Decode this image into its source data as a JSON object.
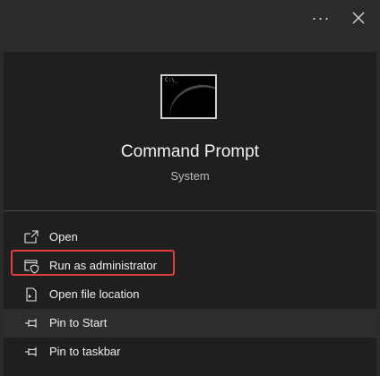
{
  "header": {
    "more_glyph": "···"
  },
  "app": {
    "name": "Command Prompt",
    "category": "System",
    "icon": "terminal-icon",
    "icon_glyph": "C:\\_"
  },
  "menu": {
    "items": [
      {
        "label": "Open",
        "icon": "open-window-icon"
      },
      {
        "label": "Run as administrator",
        "icon": "shield-window-icon"
      },
      {
        "label": "Open file location",
        "icon": "file-location-icon"
      },
      {
        "label": "Pin to Start",
        "icon": "pin-icon"
      },
      {
        "label": "Pin to taskbar",
        "icon": "pin-icon"
      }
    ],
    "highlighted_index": 3
  },
  "colors": {
    "background": "#2b2b2b",
    "panel": "#1f1f1f",
    "hover": "#2d2d2d",
    "highlight_border": "#e0403a"
  }
}
